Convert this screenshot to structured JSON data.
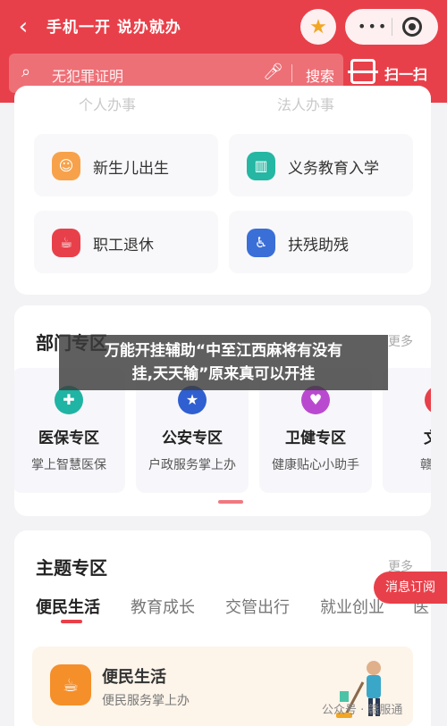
{
  "header": {
    "title": "手机一开 说办就办",
    "back_icon": "chevron-left-icon",
    "favorite_icon": "star-icon",
    "more_icon": "more-dots-icon",
    "close_icon": "target-circle-icon"
  },
  "search": {
    "placeholder": "无犯罪证明",
    "button": "搜索",
    "scan_label": "扫一扫"
  },
  "tabs_ghost": [
    "个人办事",
    "法人办事"
  ],
  "services": [
    {
      "label": "新生儿出生",
      "icon": "baby-icon",
      "color": "#f7a24a"
    },
    {
      "label": "义务教育入学",
      "icon": "book-icon",
      "color": "#25b7a3"
    },
    {
      "label": "职工退休",
      "icon": "cup-icon",
      "color": "#e8404a"
    },
    {
      "label": "扶残助残",
      "icon": "wheelchair-icon",
      "color": "#3a6fd8"
    }
  ],
  "departments": {
    "title": "部门专区",
    "more": "更多",
    "zones": [
      {
        "title": "医保专区",
        "subtitle": "掌上智慧医保",
        "icon": "medical-plus-icon",
        "color": "#1fb4a3"
      },
      {
        "title": "公安专区",
        "subtitle": "户政服务掌上办",
        "icon": "police-badge-icon",
        "color": "#2f5fd0"
      },
      {
        "title": "卫健专区",
        "subtitle": "健康贴心小助手",
        "icon": "heart-plus-icon",
        "color": "#b94ad0"
      },
      {
        "title": "文旅",
        "subtitle": "赣鄱风",
        "icon": "travel-icon",
        "color": "#e8404a"
      }
    ]
  },
  "overlay": {
    "line1": "万能开挂辅助“中至江西麻将有没有",
    "line2": "挂,天天输”原来真可以开挂"
  },
  "themes": {
    "title": "主题专区",
    "more": "更多",
    "categories": [
      "便民生活",
      "教育成长",
      "交管出行",
      "就业创业",
      "医"
    ],
    "feature_title": "便民生活",
    "feature_subtitle": "便民服务掌上办",
    "feature_icon": "hand-cup-icon"
  },
  "float_button": "消息订阅",
  "watermark": "公众号 · 赣服通",
  "colors": {
    "brand": "#e8404a"
  }
}
